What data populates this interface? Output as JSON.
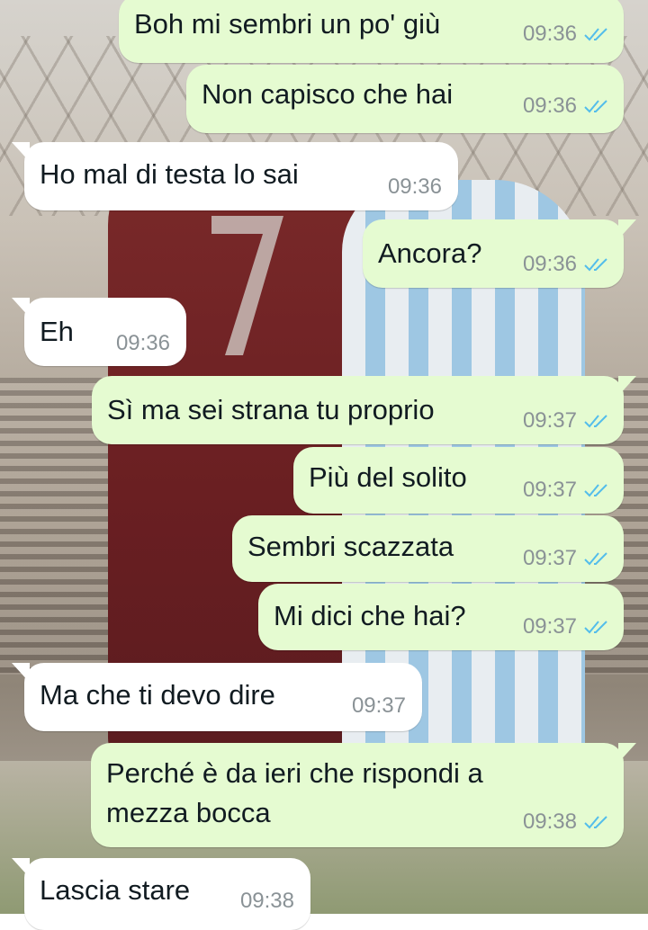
{
  "colors": {
    "outgoing_bubble": "#e5fbd1",
    "incoming_bubble": "#ffffff",
    "timestamp": "#8a9296",
    "read_ticks": "#53bdeb"
  },
  "messages": [
    {
      "direction": "out",
      "text": "Boh mi sembri un po' giù",
      "time": "09:36",
      "status": "read"
    },
    {
      "direction": "out",
      "text": "Non capisco che hai",
      "time": "09:36",
      "status": "read"
    },
    {
      "direction": "in",
      "text": "Ho mal di testa lo sai",
      "time": "09:36"
    },
    {
      "direction": "out",
      "text": "Ancora?",
      "time": "09:36",
      "status": "read"
    },
    {
      "direction": "in",
      "text": "Eh",
      "time": "09:36"
    },
    {
      "direction": "out",
      "text": "Sì ma sei strana tu proprio",
      "time": "09:37",
      "status": "read"
    },
    {
      "direction": "out",
      "text": "Più del solito",
      "time": "09:37",
      "status": "read"
    },
    {
      "direction": "out",
      "text": "Sembri scazzata",
      "time": "09:37",
      "status": "read"
    },
    {
      "direction": "out",
      "text": "Mi dici che hai?",
      "time": "09:37",
      "status": "read"
    },
    {
      "direction": "in",
      "text": "Ma che ti devo dire",
      "time": "09:37"
    },
    {
      "direction": "out",
      "text_lines": [
        "Perché è da ieri che rispondi a",
        "mezza bocca"
      ],
      "time": "09:38",
      "status": "read"
    },
    {
      "direction": "in",
      "text": "Lascia stare",
      "time": "09:38"
    }
  ]
}
